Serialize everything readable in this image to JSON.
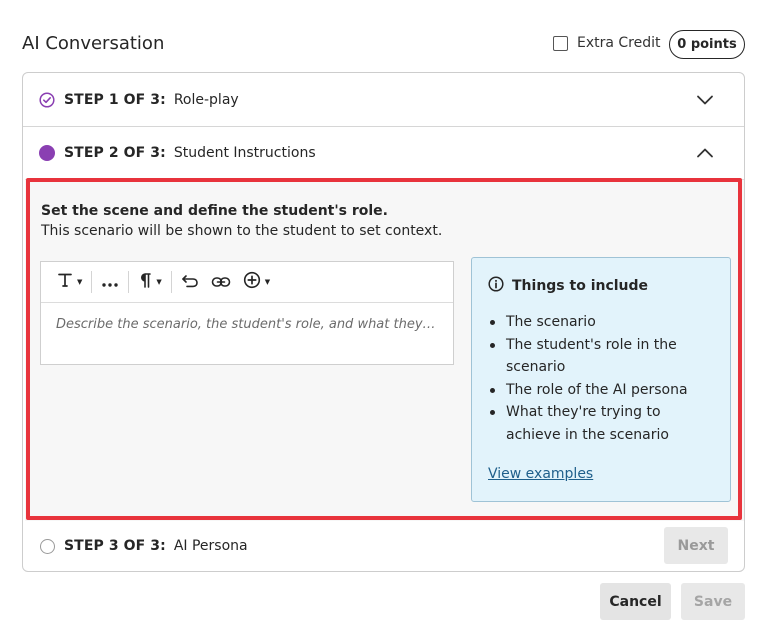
{
  "header": {
    "title": "AI Conversation",
    "extra_credit_label": "Extra Credit",
    "points": "0 points"
  },
  "steps": [
    {
      "prefix": "STEP 1 OF 3:",
      "name": "Role-play",
      "status": "complete"
    },
    {
      "prefix": "STEP 2 OF 3:",
      "name": "Student Instructions",
      "status": "current"
    },
    {
      "prefix": "STEP 3 OF 3:",
      "name": "AI Persona",
      "status": "upcoming"
    }
  ],
  "panel": {
    "heading": "Set the scene and define the student's role.",
    "subtext": "This scenario will be shown to the student to set context.",
    "editor_placeholder": "Describe the scenario, the student's role, and what they're tr..."
  },
  "tips": {
    "title": "Things to include",
    "items": [
      "The scenario",
      "The student's role in the scenario",
      "The role of the AI persona",
      "What they're trying to achieve in the scenario"
    ],
    "link": "View examples"
  },
  "buttons": {
    "next": "Next",
    "cancel": "Cancel",
    "save": "Save"
  },
  "colors": {
    "accent_purple": "#8a3fb2",
    "highlight_red": "#e8333c",
    "tips_background": "#e2f3fb",
    "link_blue": "#1f5f8b"
  }
}
